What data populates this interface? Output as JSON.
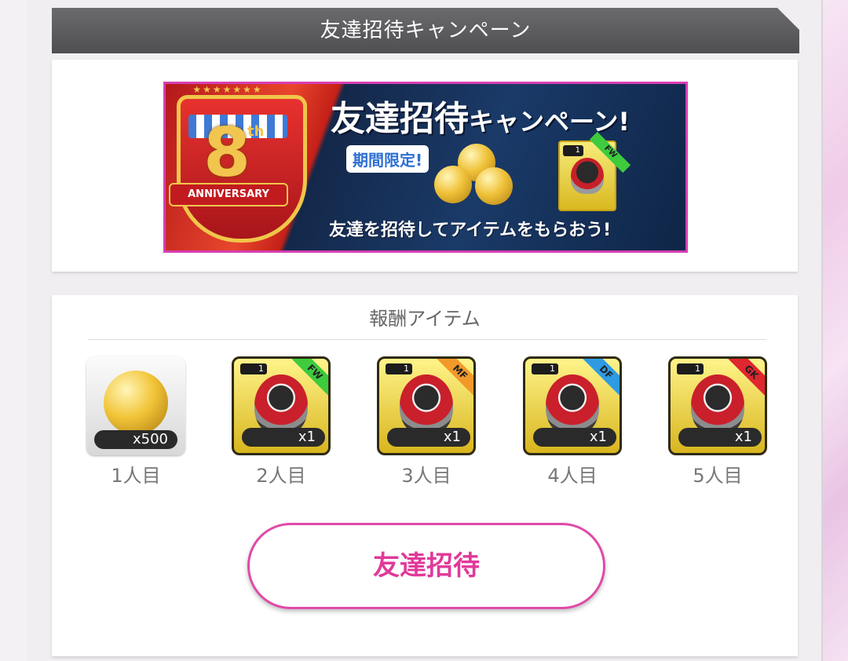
{
  "header": {
    "title": "友達招待キャンペーン"
  },
  "banner": {
    "title_main": "友達招待",
    "title_rest": "キャンペーン!",
    "limited_tag": "期間限定!",
    "subtitle": "友達を招待してアイテムをもらおう!",
    "anniversary_number": "8",
    "anniversary_suffix": "th",
    "anniversary_text": "ANNIVERSARY",
    "card_level": "1",
    "card_position": "FW"
  },
  "rewards": {
    "title": "報酬アイテム",
    "items": [
      {
        "type": "coin",
        "quantity": "x500",
        "label": "1人目"
      },
      {
        "type": "player-card",
        "level": "1",
        "position": "FW",
        "position_color": "#3ecb3e",
        "quantity": "x1",
        "label": "2人目"
      },
      {
        "type": "player-card",
        "level": "1",
        "position": "MF",
        "position_color": "#f3992a",
        "quantity": "x1",
        "label": "3人目"
      },
      {
        "type": "player-card",
        "level": "1",
        "position": "DF",
        "position_color": "#2e9be3",
        "quantity": "x1",
        "label": "4人目"
      },
      {
        "type": "player-card",
        "level": "1",
        "position": "GK",
        "position_color": "#e0262f",
        "quantity": "x1",
        "label": "5人目"
      }
    ]
  },
  "actions": {
    "invite_label": "友達招待"
  },
  "colors": {
    "accent": "#e0399a",
    "header_bg": "#5a5a5c"
  }
}
